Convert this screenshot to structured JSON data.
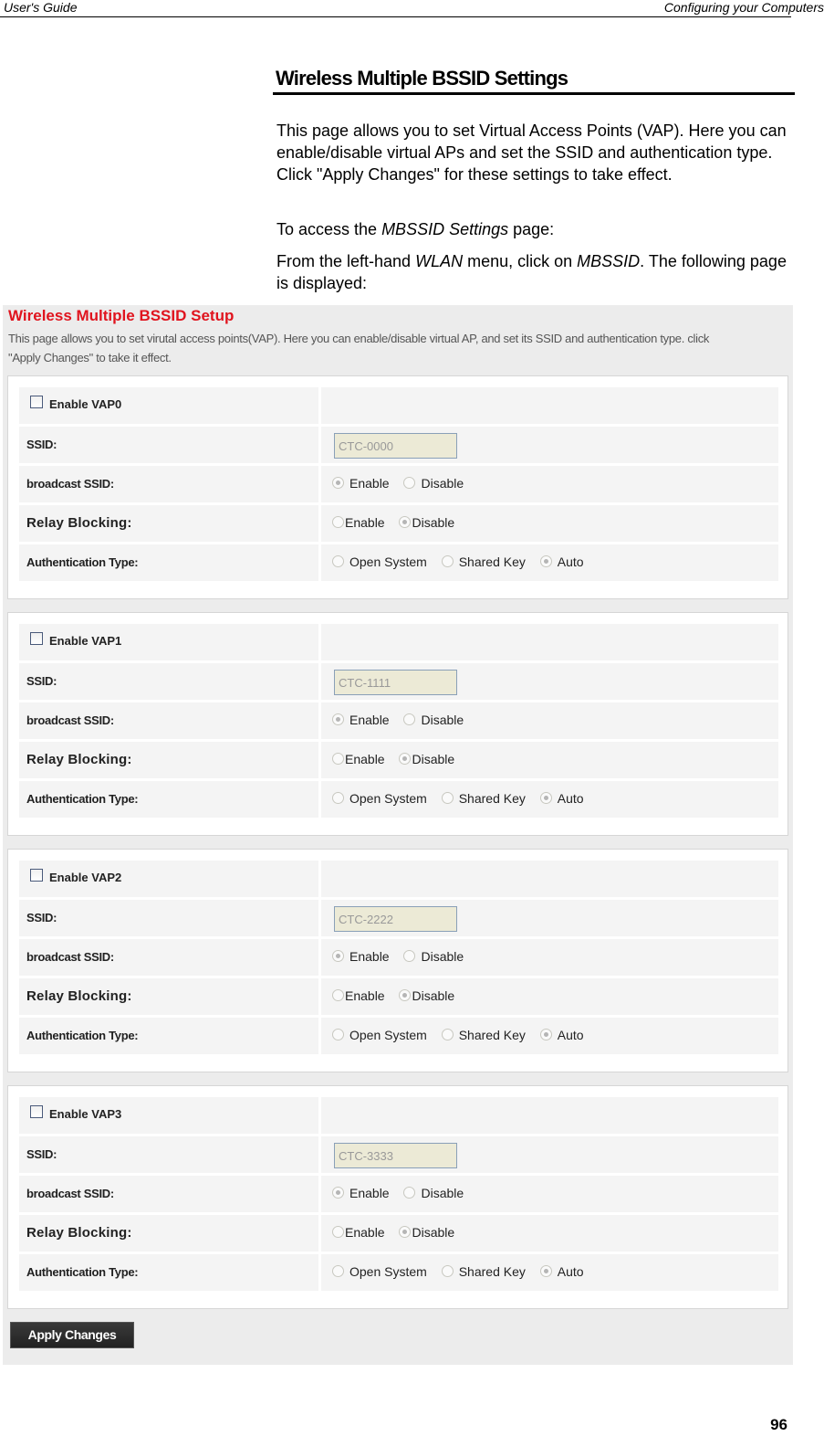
{
  "header": {
    "left": "User's Guide",
    "right": "Configuring your Computers"
  },
  "doc": {
    "title": "Wireless Multiple BSSID Settings",
    "intro": "This page allows you to set Virtual Access Points (VAP). Here you can enable/disable virtual APs and set the SSID and authentication type. Click \"Apply Changes\" for these settings to take effect.",
    "access_prefix": "To access the ",
    "access_italic": "MBSSID Settings",
    "access_suffix": " page:",
    "from_prefix": "From the left-hand ",
    "from_italic1": "WLAN",
    "from_mid": " menu, click on ",
    "from_italic2": "MBSSID",
    "from_suffix": ". The following page is displayed:"
  },
  "screen": {
    "title": "Wireless Multiple BSSID Setup",
    "description": "This page allows you to set virutal access points(VAP). Here you can enable/disable virtual AP, and set its SSID and authentication type. click \"Apply Changes\" to take it effect.",
    "labels": {
      "ssid": "SSID:",
      "broadcast": "broadcast SSID:",
      "relay": "Relay Blocking:",
      "auth": "Authentication Type:",
      "enable": "Enable",
      "disable": "Disable",
      "open": "Open System",
      "shared": "Shared Key",
      "auto": "Auto"
    },
    "vaps": [
      {
        "enable_label": "Enable VAP0",
        "enabled": false,
        "ssid": "CTC-0000",
        "broadcast": "Enable",
        "relay": "Disable",
        "auth": "Auto"
      },
      {
        "enable_label": "Enable VAP1",
        "enabled": false,
        "ssid": "CTC-1111",
        "broadcast": "Enable",
        "relay": "Disable",
        "auth": "Auto"
      },
      {
        "enable_label": "Enable VAP2",
        "enabled": false,
        "ssid": "CTC-2222",
        "broadcast": "Enable",
        "relay": "Disable",
        "auth": "Auto"
      },
      {
        "enable_label": "Enable VAP3",
        "enabled": false,
        "ssid": "CTC-3333",
        "broadcast": "Enable",
        "relay": "Disable",
        "auth": "Auto"
      }
    ],
    "apply_label": "Apply Changes",
    "colors": {
      "title": "#e0141e",
      "ssid_bg": "#ecead6",
      "button_bg": "#2a2a2a"
    }
  },
  "footer": {
    "page_number": "96"
  }
}
